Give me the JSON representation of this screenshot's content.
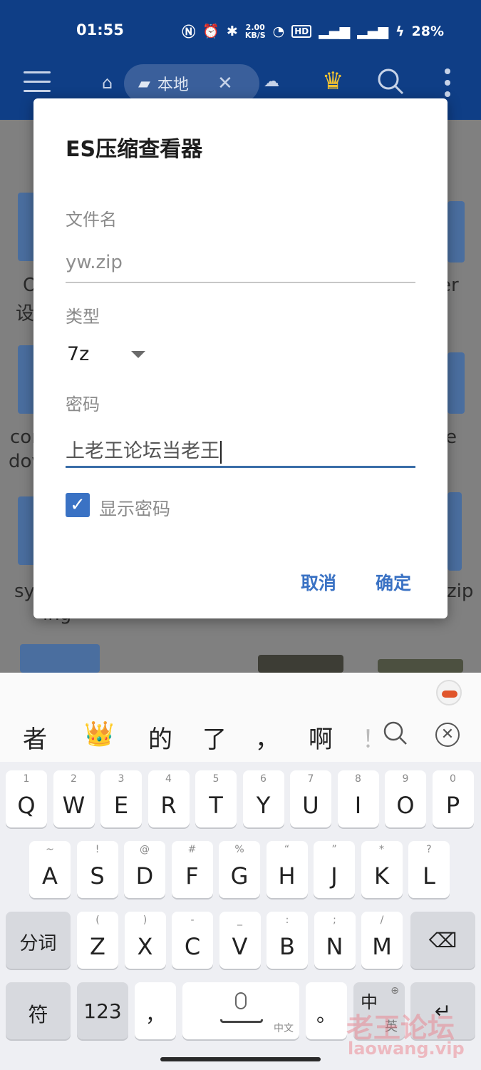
{
  "status": {
    "time": "01:55",
    "net_speed": "2.00\nKB/S",
    "battery": "28%"
  },
  "appbar": {
    "tab_label": "本地"
  },
  "background_files": {
    "labels": [
      "O",
      "设",
      "er",
      "cor",
      "dov",
      "e",
      "sy",
      "zip",
      "ing"
    ]
  },
  "dialog": {
    "title": "ES压缩查看器",
    "filename_label": "文件名",
    "filename_value": "yw.zip",
    "type_label": "类型",
    "type_value": "7z",
    "password_label": "密码",
    "password_value": "上老王论坛当老王",
    "show_password_label": "显示密码",
    "show_password_checked": true,
    "cancel_label": "取消",
    "ok_label": "确定",
    "accent_color": "#3a72c4"
  },
  "keyboard": {
    "candidates": [
      "者",
      "👑",
      "的",
      "了",
      "，",
      "啊",
      "！"
    ],
    "row1": [
      {
        "main": "Q",
        "sub": "1"
      },
      {
        "main": "W",
        "sub": "2"
      },
      {
        "main": "E",
        "sub": "3"
      },
      {
        "main": "R",
        "sub": "4"
      },
      {
        "main": "T",
        "sub": "5"
      },
      {
        "main": "Y",
        "sub": "6"
      },
      {
        "main": "U",
        "sub": "7"
      },
      {
        "main": "I",
        "sub": "8"
      },
      {
        "main": "O",
        "sub": "9"
      },
      {
        "main": "P",
        "sub": "0"
      }
    ],
    "row2": [
      {
        "main": "A",
        "sub": "~"
      },
      {
        "main": "S",
        "sub": "!"
      },
      {
        "main": "D",
        "sub": "@"
      },
      {
        "main": "F",
        "sub": "#"
      },
      {
        "main": "G",
        "sub": "%"
      },
      {
        "main": "H",
        "sub": "“"
      },
      {
        "main": "J",
        "sub": "”"
      },
      {
        "main": "K",
        "sub": "*"
      },
      {
        "main": "L",
        "sub": "?"
      }
    ],
    "row3": [
      {
        "main": "Z",
        "sub": "("
      },
      {
        "main": "X",
        "sub": ")"
      },
      {
        "main": "C",
        "sub": "-"
      },
      {
        "main": "V",
        "sub": "_"
      },
      {
        "main": "B",
        "sub": ":"
      },
      {
        "main": "N",
        "sub": ";"
      },
      {
        "main": "M",
        "sub": "/"
      }
    ],
    "fenci_label": "分词",
    "symbols_label": "符",
    "numbers_label": "123",
    "comma_label": "，",
    "space_label": "中文",
    "period_label": "。",
    "lang_label": "中",
    "lang_sub": "英"
  },
  "watermark": {
    "text": "老王论坛",
    "url": "laowang.vip"
  }
}
